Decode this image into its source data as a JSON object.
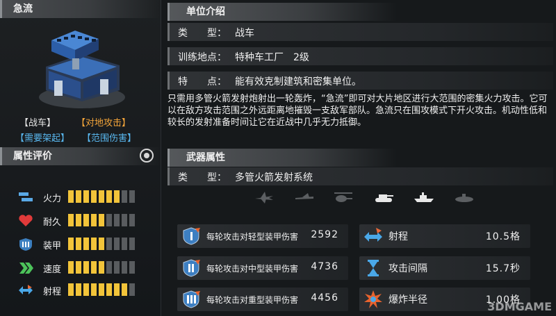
{
  "left": {
    "unit_name": "急流",
    "tags": [
      "【战车】",
      "【对地攻击】",
      "【需要架起】",
      "【范围伤害】"
    ],
    "attr_title": "属性评价",
    "stats": [
      {
        "label": "火力",
        "icon": "rocket-icon",
        "filled": 7,
        "total": 9
      },
      {
        "label": "耐久",
        "icon": "heart-icon",
        "filled": 5,
        "total": 9
      },
      {
        "label": "装甲",
        "icon": "armor-icon",
        "filled": 5,
        "total": 9
      },
      {
        "label": "速度",
        "icon": "chevrons-icon",
        "filled": 5,
        "total": 9
      },
      {
        "label": "射程",
        "icon": "double-arrow-icon",
        "filled": 8,
        "total": 9
      }
    ]
  },
  "right": {
    "unit_intro_title": "单位介绍",
    "type_key": "类　　型：",
    "type_val": "战车",
    "train_key": "训练地点：",
    "train_val": "特种车工厂　2级",
    "feature_key": "特　　点：",
    "feature_val": "能有效克制建筑和密集单位。",
    "description": "只需用多管火箭发射炮射出一轮轰炸，“急流”即可对大片地区进行大范围的密集火力攻击。它可以在敌方攻击范围之外远距离地摧毁一支敌军部队。急流只在围攻模式下开火攻击。机动性低和较长的发射准备时间让它在近战中几乎无力抵御。",
    "weapon_title": "武器属性",
    "weapon_type_key": "类　　型：",
    "weapon_type_val": "多管火箭发射系统",
    "targets": [
      {
        "icon": "jet-icon",
        "active": false
      },
      {
        "icon": "plane-icon",
        "active": false
      },
      {
        "icon": "helicopter-icon",
        "active": false
      },
      {
        "icon": "tank-icon",
        "active": true
      },
      {
        "icon": "ship-icon",
        "active": true
      },
      {
        "icon": "submarine-icon",
        "active": false
      }
    ],
    "damage": [
      {
        "label": "每轮攻击对轻型装甲伤害",
        "value": "2592"
      },
      {
        "label": "每轮攻击对中型装甲伤害",
        "value": "4736"
      },
      {
        "label": "每轮攻击对重型装甲伤害",
        "value": "4456"
      }
    ],
    "misc": [
      {
        "label": "射程",
        "value": "10.5格"
      },
      {
        "label": "攻击间隔",
        "value": "15.7秒"
      },
      {
        "label": "爆炸半径",
        "value": "1.00格"
      }
    ]
  },
  "watermark": "3DMGAME"
}
